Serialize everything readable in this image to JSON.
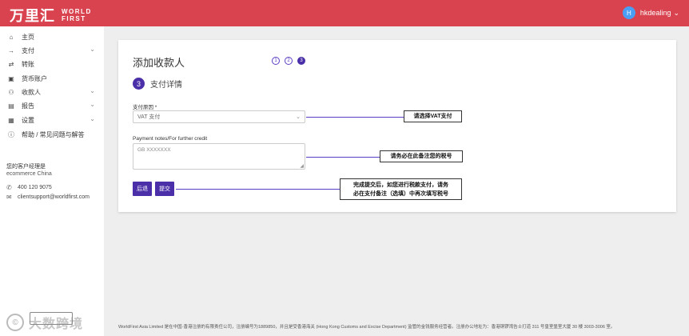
{
  "header": {
    "logo_cn": "万里汇",
    "logo_en_line1": "WORLD",
    "logo_en_line2": "FIRST",
    "avatar_letter": "H",
    "username": "hkdealing"
  },
  "sidebar": {
    "items": [
      {
        "label": "主页",
        "icon": "home-icon"
      },
      {
        "label": "支付",
        "icon": "arrow-right-icon",
        "expandable": true
      },
      {
        "label": "转账",
        "icon": "transfer-icon"
      },
      {
        "label": "货币账户",
        "icon": "wallet-icon"
      },
      {
        "label": "收款人",
        "icon": "users-icon",
        "expandable": true
      },
      {
        "label": "报告",
        "icon": "report-icon",
        "expandable": true
      },
      {
        "label": "设置",
        "icon": "settings-icon",
        "expandable": true
      },
      {
        "label": "帮助 / 常见问题与解答",
        "icon": "help-icon"
      }
    ],
    "account_manager_title": "您的客户经理是",
    "account_manager_name": "ecommerce China",
    "phone": "400 120 9075",
    "email": "clientsupport@worldfirst.com",
    "watermark_text": "大数跨境"
  },
  "main": {
    "title": "添加收款人",
    "steps": [
      "1",
      "2",
      "3"
    ],
    "active_step": 3,
    "section_number": "3",
    "section_title": "支付详情",
    "reason_label": "支付原因 *",
    "reason_value": "VAT 支付",
    "notes_label": "Payment notes/For further credit",
    "notes_placeholder": "GB XXXXXXX",
    "back_button": "后退",
    "submit_button": "提交"
  },
  "annotations": {
    "select_vat": "请选择VAT支付",
    "tax_note": "请务必在此备注您的税号",
    "submit_note_line1": "完成提交后，如您进行税款支付，请务",
    "submit_note_line2": "必在支付备注（选填）中再次填写税号"
  },
  "footer": {
    "text": "WorldFirst Asia Limited 是在中国·香港注册的有限责任公司，注册编号为1889850，并且是受香港海关 (Hong Kong Customs and Excise Department) 监管的金钱服务经营者。注册办公地址为：香港铜锣湾告士打道 311 号皇室堡室大厦 30 楼 3003-3006 室。"
  },
  "colors": {
    "header": "#d9434f",
    "primary": "#4a2fa8",
    "annotation_line": "#5b3cc4"
  }
}
